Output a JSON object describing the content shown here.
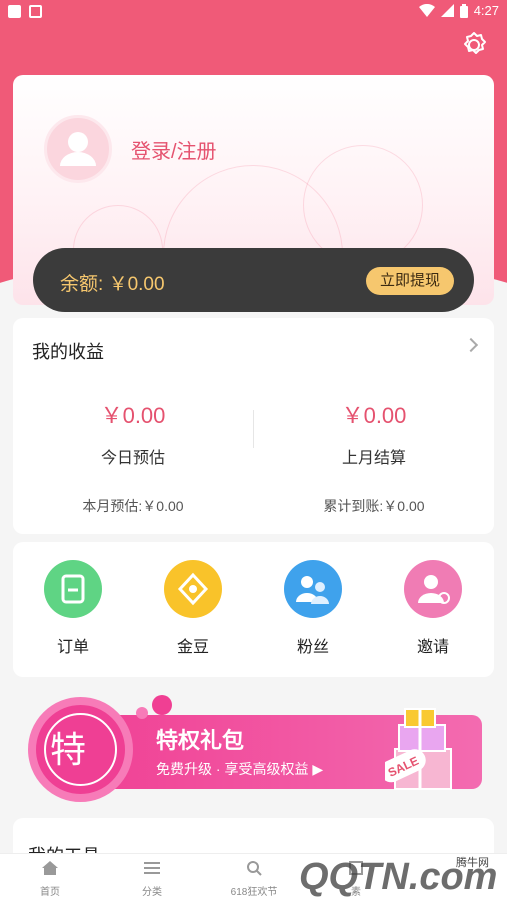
{
  "status": {
    "time": "4:27"
  },
  "profile": {
    "login_label": "登录/注册"
  },
  "balance": {
    "label": "余额:",
    "amount": "￥0.00",
    "withdraw_label": "立即提现"
  },
  "earnings": {
    "title": "我的收益",
    "today": {
      "value": "￥0.00",
      "label": "今日预估"
    },
    "last_month": {
      "value": "￥0.00",
      "label": "上月结算"
    },
    "month_estimate": "本月预估:￥0.00",
    "total_received": "累计到账:￥0.00"
  },
  "menu": [
    {
      "label": "订单",
      "icon": "order-icon",
      "color": "#5fd484"
    },
    {
      "label": "金豆",
      "icon": "gold-bean-icon",
      "color": "#f9c32a"
    },
    {
      "label": "粉丝",
      "icon": "fans-icon",
      "color": "#3fa2ec"
    },
    {
      "label": "邀请",
      "icon": "invite-icon",
      "color": "#f07cb4"
    }
  ],
  "banner": {
    "badge": "特",
    "title": "特权礼包",
    "subtitle": "免费升级 · 享受高级权益 ▶",
    "sale": "SALE"
  },
  "tools": {
    "title": "我的工具"
  },
  "tabs": [
    {
      "label": "首页",
      "icon": "home-icon"
    },
    {
      "label": "分类",
      "icon": "category-icon"
    },
    {
      "label": "618狂欢节",
      "icon": "search-icon"
    },
    {
      "label": "素",
      "icon": "material-icon"
    }
  ],
  "watermark": {
    "text": "QQTN.com",
    "site": "腾牛网"
  }
}
